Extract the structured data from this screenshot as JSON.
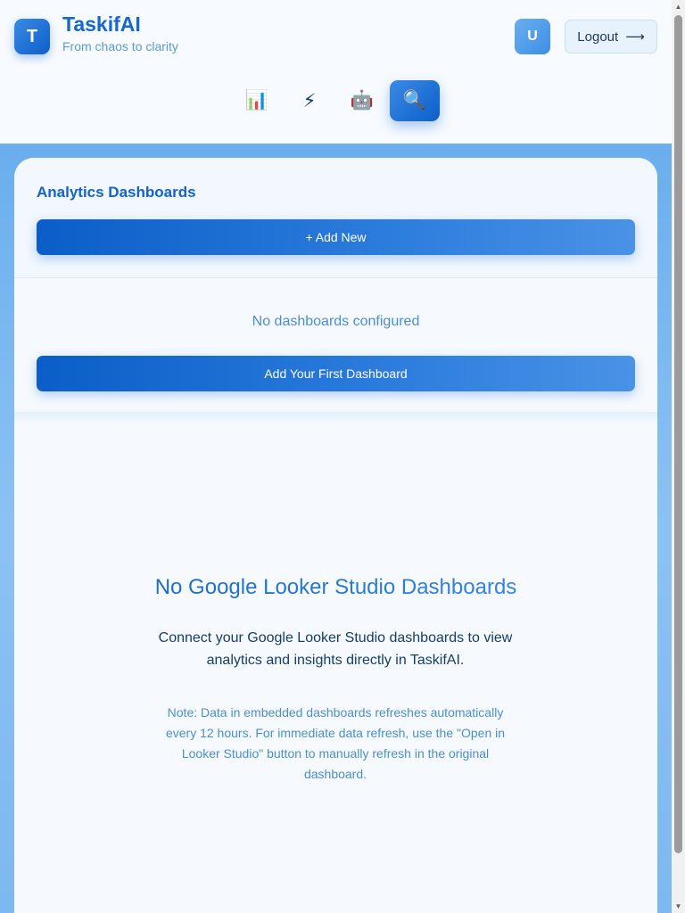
{
  "brand": {
    "logo_letter": "T",
    "name": "TaskifAI",
    "tagline": "From chaos to clarity"
  },
  "user": {
    "avatar_letter": "U",
    "logout_label": "Logout",
    "logout_arrow": "⟶"
  },
  "nav": [
    {
      "icon": "📊",
      "icon_name": "bar-chart-icon",
      "active": false
    },
    {
      "icon": "⚡",
      "icon_name": "lightning-icon",
      "active": false
    },
    {
      "icon": "🤖",
      "icon_name": "robot-icon",
      "active": false
    },
    {
      "icon": "🔍",
      "icon_name": "search-icon",
      "active": true
    }
  ],
  "panel": {
    "title": "Analytics Dashboards",
    "add_new_label": "+ Add New",
    "empty_list_text": "No dashboards configured",
    "add_first_label": "Add Your First Dashboard"
  },
  "empty_state": {
    "title": "No Google Looker Studio Dashboards",
    "description": "Connect your Google Looker Studio dashboards to view analytics and insights directly in TaskifAI.",
    "note": "Note: Data in embedded dashboards refreshes automatically every 12 hours. For immediate data refresh, use the \"Open in Looker Studio\" button to manually refresh in the original dashboard."
  },
  "colors": {
    "accent": "#1468cf",
    "accent_light": "#4a92e6",
    "background": "#f6fafe"
  }
}
